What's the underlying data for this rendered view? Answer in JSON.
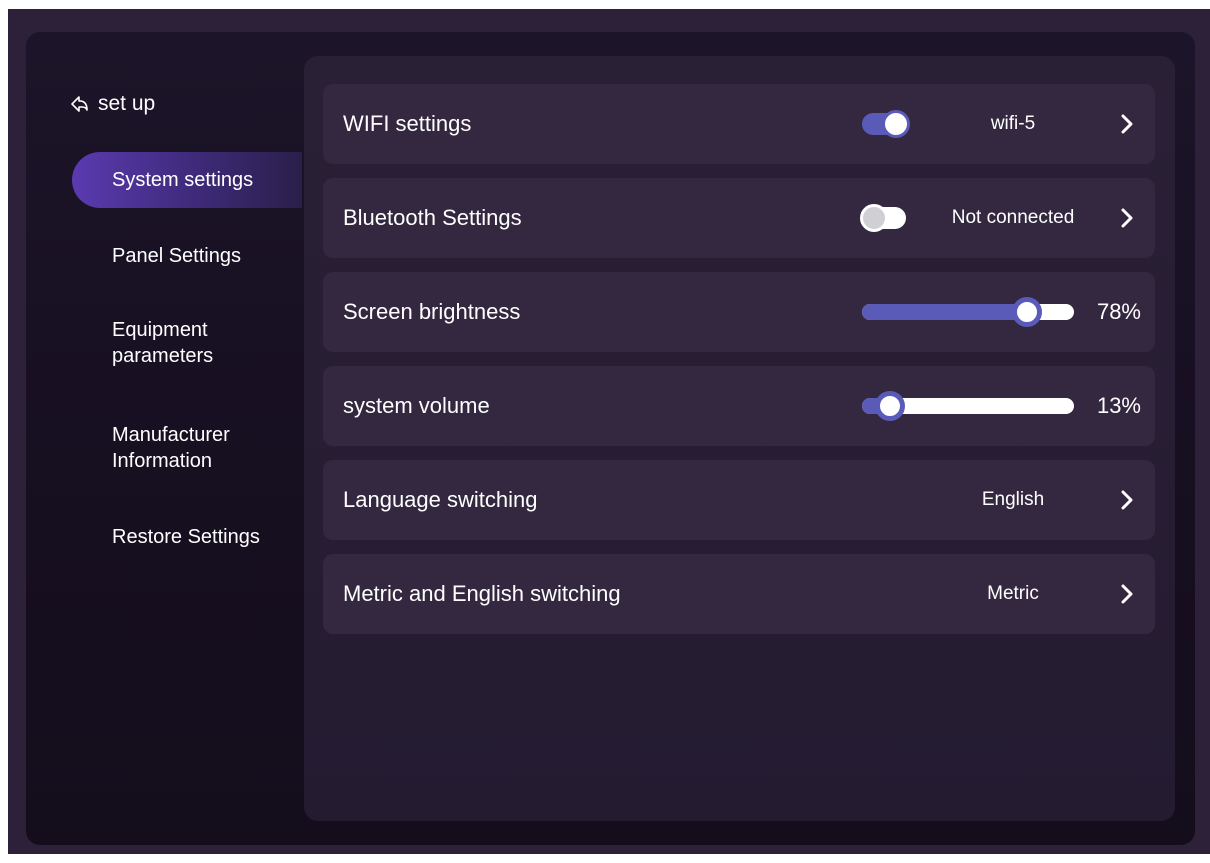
{
  "header": {
    "back_label": "set up"
  },
  "sidebar": {
    "items": [
      {
        "label": "System settings",
        "active": true
      },
      {
        "label": "Panel Settings",
        "active": false
      },
      {
        "label": "Equipment\nparameters",
        "active": false
      },
      {
        "label": "Manufacturer\nInformation",
        "active": false
      },
      {
        "label": "Restore Settings",
        "active": false
      }
    ]
  },
  "settings": {
    "wifi": {
      "label": "WIFI settings",
      "enabled": true,
      "value": "wifi-5"
    },
    "bluetooth": {
      "label": "Bluetooth Settings",
      "enabled": false,
      "value": "Not connected"
    },
    "brightness": {
      "label": "Screen brightness",
      "level": 78,
      "display": "78%"
    },
    "volume": {
      "label": "system volume",
      "level": 13,
      "display": "13%"
    },
    "language": {
      "label": "Language switching",
      "value": "English"
    },
    "units": {
      "label": "Metric and English switching",
      "value": "Metric"
    }
  },
  "colors": {
    "accent": "#5a5bb8",
    "active_nav": "#5b3ab0",
    "row_background": "#33283f",
    "panel_background": "#2a2036",
    "device_background": "#1c1428"
  },
  "icons": {
    "back": "back-arrow-icon",
    "chevron": "chevron-right-icon"
  }
}
